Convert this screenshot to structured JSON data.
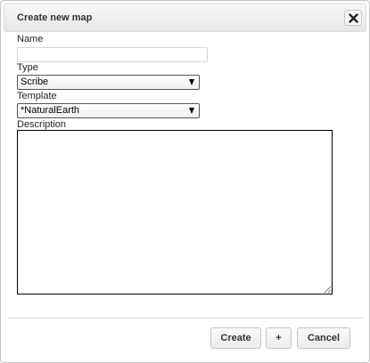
{
  "dialog": {
    "title": "Create new map",
    "close_icon": "close-icon"
  },
  "form": {
    "name_label": "Name",
    "name_value": "",
    "name_placeholder": "",
    "type_label": "Type",
    "type_value": "Scribe",
    "template_label": "Template",
    "template_value": "*NaturalEarth",
    "description_label": "Description",
    "description_value": ""
  },
  "buttons": {
    "create": "Create",
    "plus": "+",
    "cancel": "Cancel"
  }
}
